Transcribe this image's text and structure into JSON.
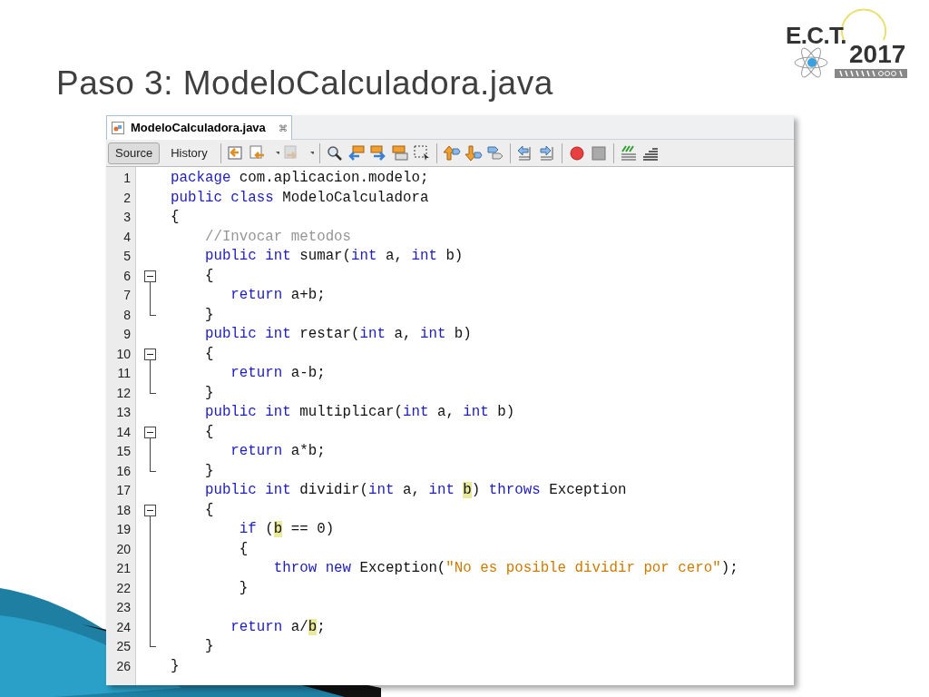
{
  "slide_title": "Paso 3: ModeloCalculadora.java",
  "logo": {
    "letters": "E.C.T.",
    "year": "2017"
  },
  "editor": {
    "file_tab": {
      "label": "ModeloCalculadora.java",
      "close": "⌘",
      "selected": true
    },
    "view_tabs": [
      {
        "label": "Source",
        "selected": true
      },
      {
        "label": "History",
        "selected": false
      }
    ],
    "lines": [
      {
        "number": "1",
        "kind": "plain",
        "segments": [
          {
            "kind": "keyword",
            "text": "package"
          },
          {
            "kind": "plain",
            "text": " com.aplicacion.modelo;"
          }
        ]
      },
      {
        "number": "2",
        "kind": "plain",
        "segments": [
          {
            "kind": "keyword",
            "text": "public class"
          },
          {
            "kind": "plain",
            "text": " ModeloCalculadora"
          }
        ]
      },
      {
        "number": "3",
        "kind": "plain",
        "segments": [
          {
            "kind": "plain",
            "text": "{"
          }
        ]
      },
      {
        "number": "4",
        "kind": "plain",
        "segments": [
          {
            "kind": "comment",
            "text": "    //Invocar metodos"
          }
        ]
      },
      {
        "number": "5",
        "kind": "plain",
        "segments": [
          {
            "kind": "keyword",
            "text": "    public int"
          },
          {
            "kind": "plain",
            "text": " sumar("
          },
          {
            "kind": "keyword",
            "text": "int"
          },
          {
            "kind": "plain",
            "text": " a, "
          },
          {
            "kind": "keyword",
            "text": "int"
          },
          {
            "kind": "plain",
            "text": " b)"
          }
        ]
      },
      {
        "number": "6",
        "kind": "fold_start",
        "expanded": true,
        "segments": [
          {
            "kind": "plain",
            "text": "    {"
          }
        ]
      },
      {
        "number": "7",
        "kind": "fold_inner",
        "segments": [
          {
            "kind": "keyword",
            "text": "       return"
          },
          {
            "kind": "plain",
            "text": " a+b;"
          }
        ]
      },
      {
        "number": "8",
        "kind": "fold_end",
        "segments": [
          {
            "kind": "plain",
            "text": "    }"
          }
        ]
      },
      {
        "number": "9",
        "kind": "plain",
        "segments": [
          {
            "kind": "keyword",
            "text": "    public int"
          },
          {
            "kind": "plain",
            "text": " restar("
          },
          {
            "kind": "keyword",
            "text": "int"
          },
          {
            "kind": "plain",
            "text": " a, "
          },
          {
            "kind": "keyword",
            "text": "int"
          },
          {
            "kind": "plain",
            "text": " b)"
          }
        ]
      },
      {
        "number": "10",
        "kind": "fold_start",
        "expanded": true,
        "segments": [
          {
            "kind": "plain",
            "text": "    {"
          }
        ]
      },
      {
        "number": "11",
        "kind": "fold_inner",
        "segments": [
          {
            "kind": "keyword",
            "text": "       return"
          },
          {
            "kind": "plain",
            "text": " a-b;"
          }
        ]
      },
      {
        "number": "12",
        "kind": "fold_end",
        "segments": [
          {
            "kind": "plain",
            "text": "    }"
          }
        ]
      },
      {
        "number": "13",
        "kind": "plain",
        "segments": [
          {
            "kind": "keyword",
            "text": "    public int"
          },
          {
            "kind": "plain",
            "text": " multiplicar("
          },
          {
            "kind": "keyword",
            "text": "int"
          },
          {
            "kind": "plain",
            "text": " a, "
          },
          {
            "kind": "keyword",
            "text": "int"
          },
          {
            "kind": "plain",
            "text": " b)"
          }
        ]
      },
      {
        "number": "14",
        "kind": "fold_start",
        "expanded": true,
        "segments": [
          {
            "kind": "plain",
            "text": "    {"
          }
        ]
      },
      {
        "number": "15",
        "kind": "fold_inner",
        "segments": [
          {
            "kind": "keyword",
            "text": "       return"
          },
          {
            "kind": "plain",
            "text": " a*b;"
          }
        ]
      },
      {
        "number": "16",
        "kind": "fold_end",
        "segments": [
          {
            "kind": "plain",
            "text": "    }"
          }
        ]
      },
      {
        "number": "17",
        "kind": "plain",
        "segments": [
          {
            "kind": "keyword",
            "text": "    public int"
          },
          {
            "kind": "plain",
            "text": " dividir("
          },
          {
            "kind": "keyword",
            "text": "int"
          },
          {
            "kind": "plain",
            "text": " a, "
          },
          {
            "kind": "keyword",
            "text": "int "
          },
          {
            "kind": "highlight",
            "text": "b"
          },
          {
            "kind": "plain",
            "text": ") "
          },
          {
            "kind": "keyword",
            "text": "throws"
          },
          {
            "kind": "plain",
            "text": " Exception"
          }
        ]
      },
      {
        "number": "18",
        "kind": "fold_start",
        "expanded": true,
        "segments": [
          {
            "kind": "plain",
            "text": "    {"
          }
        ]
      },
      {
        "number": "19",
        "kind": "fold_inner",
        "segments": [
          {
            "kind": "keyword",
            "text": "        if"
          },
          {
            "kind": "plain",
            "text": " ("
          },
          {
            "kind": "highlight",
            "text": "b"
          },
          {
            "kind": "plain",
            "text": " == 0)"
          }
        ]
      },
      {
        "number": "20",
        "kind": "fold_inner",
        "segments": [
          {
            "kind": "plain",
            "text": "        {"
          }
        ]
      },
      {
        "number": "21",
        "kind": "fold_inner",
        "segments": [
          {
            "kind": "keyword",
            "text": "            throw new"
          },
          {
            "kind": "plain",
            "text": " Exception("
          },
          {
            "kind": "string",
            "text": "\"No es posible dividir por cero\""
          },
          {
            "kind": "plain",
            "text": ");"
          }
        ]
      },
      {
        "number": "22",
        "kind": "fold_inner",
        "segments": [
          {
            "kind": "plain",
            "text": "        }"
          }
        ]
      },
      {
        "number": "23",
        "kind": "fold_inner"
      },
      {
        "number": "24",
        "kind": "fold_inner",
        "segments": [
          {
            "kind": "keyword",
            "text": "       return"
          },
          {
            "kind": "plain",
            "text": " a/"
          },
          {
            "kind": "highlight",
            "text": "b"
          },
          {
            "kind": "plain",
            "text": ";"
          }
        ]
      },
      {
        "number": "25",
        "kind": "fold_end",
        "segments": [
          {
            "kind": "plain",
            "text": "    }"
          }
        ]
      },
      {
        "number": "26",
        "kind": "plain",
        "segments": [
          {
            "kind": "plain",
            "text": "}"
          }
        ]
      }
    ]
  }
}
